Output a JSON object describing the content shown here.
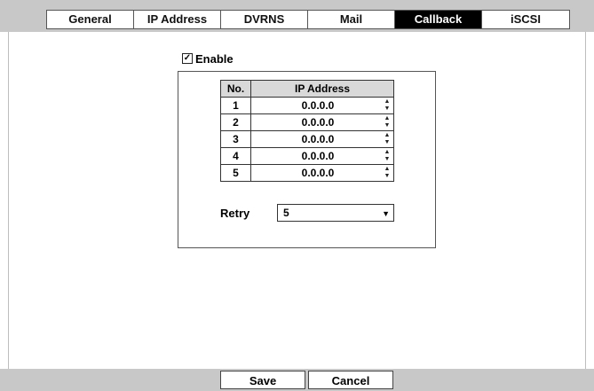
{
  "tabs": [
    {
      "label": "General"
    },
    {
      "label": "IP Address"
    },
    {
      "label": "DVRNS"
    },
    {
      "label": "Mail"
    },
    {
      "label": "Callback",
      "active": true
    },
    {
      "label": "iSCSI"
    }
  ],
  "enable": {
    "label": "Enable",
    "checked": true,
    "check_glyph": "✓"
  },
  "table": {
    "headers": {
      "no": "No.",
      "ip": "IP Address"
    },
    "rows": [
      {
        "no": "1",
        "ip": "0.0.0.0"
      },
      {
        "no": "2",
        "ip": "0.0.0.0"
      },
      {
        "no": "3",
        "ip": "0.0.0.0"
      },
      {
        "no": "4",
        "ip": "0.0.0.0"
      },
      {
        "no": "5",
        "ip": "0.0.0.0"
      }
    ],
    "spinner_icon": "up-down-spinner-icon"
  },
  "retry": {
    "label": "Retry",
    "value": "5",
    "dropdown_icon": "triangle-down-icon"
  },
  "buttons": {
    "save": "Save",
    "cancel": "Cancel"
  },
  "colors": {
    "active_tab_bg": "#000000",
    "bar_bg": "#c8c8c8",
    "header_bg": "#d9d9d9"
  }
}
